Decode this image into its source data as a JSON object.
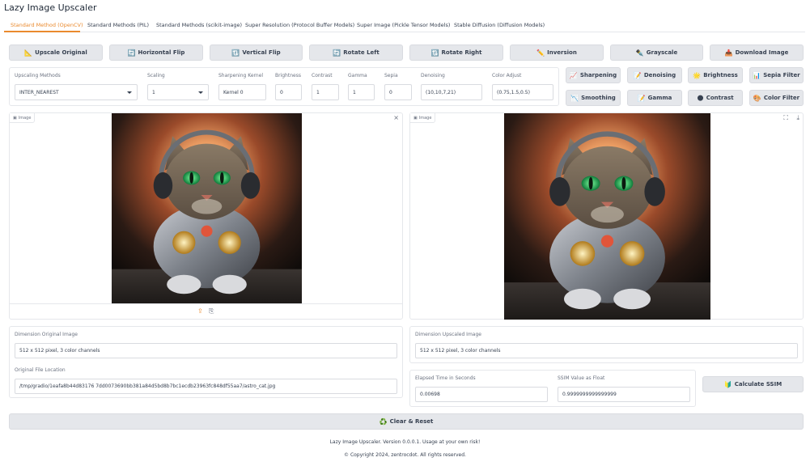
{
  "app": {
    "title": "Lazy Image Upscaler"
  },
  "tabs": [
    {
      "label": "Standard Method (OpenCV)"
    },
    {
      "label": "Standard Methods (PIL)"
    },
    {
      "label": "Standard Methods (scikit-image)"
    },
    {
      "label": "Super Resolution (Protocol Buffer Models)"
    },
    {
      "label": "Super Image (Pickle Tensor Models)"
    },
    {
      "label": "Stable Diffusion (Diffusion Models)"
    }
  ],
  "toolbar": [
    {
      "label": "Upscale Original",
      "icon": "📐"
    },
    {
      "label": "Horizontal Flip",
      "icon": "🔄"
    },
    {
      "label": "Vertical Flip",
      "icon": "🔃"
    },
    {
      "label": "Rotate Left",
      "icon": "🔄"
    },
    {
      "label": "Rotate Right",
      "icon": "🔃"
    },
    {
      "label": "Inversion",
      "icon": "✏️"
    },
    {
      "label": "Grayscale",
      "icon": "✒️"
    },
    {
      "label": "Download Image",
      "icon": "📥"
    }
  ],
  "settings": {
    "upscaling_methods": {
      "label": "Upscaling Methods",
      "value": "INTER_NEAREST"
    },
    "scaling": {
      "label": "Scaling",
      "value": "1"
    },
    "sharpening_kernel": {
      "label": "Sharpening Kernel",
      "value": "Kernel 0"
    },
    "brightness": {
      "label": "Brightness",
      "value": "0"
    },
    "contrast": {
      "label": "Contrast",
      "value": "1"
    },
    "gamma": {
      "label": "Gamma",
      "value": "1"
    },
    "sepia": {
      "label": "Sepia",
      "value": "0"
    },
    "denoising": {
      "label": "Denoising",
      "value": "(10,10,7,21)"
    },
    "color_adjust": {
      "label": "Color Adjust",
      "value": "(0.75,1.5,0.5)"
    }
  },
  "filters": [
    {
      "label": "Sharpening",
      "icon": "📈"
    },
    {
      "label": "Denoising",
      "icon": "📝"
    },
    {
      "label": "Brightness",
      "icon": "🌟"
    },
    {
      "label": "Sepia Filter",
      "icon": "📊"
    },
    {
      "label": "Smoothing",
      "icon": "📉"
    },
    {
      "label": "Gamma",
      "icon": "📝"
    },
    {
      "label": "Contrast",
      "icon": "🌑"
    },
    {
      "label": "Color Filter",
      "icon": "🎨"
    }
  ],
  "image_left": {
    "label": "Image",
    "close": "×",
    "upload": "⇪",
    "paste": "⎘"
  },
  "image_right": {
    "label": "Image",
    "fullscreen": "⛶",
    "download": "⤓"
  },
  "info": {
    "dim_original": {
      "label": "Dimension Original Image",
      "value": "512 x 512 pixel, 3 color channels"
    },
    "file_location": {
      "label": "Original File Location",
      "value": "/tmp/gradio/1eafa8b44d83176 7dd0073690bb381a84d5bd8b7bc1ecdb23963fc848df55aa7/astro_cat.jpg"
    },
    "dim_upscaled": {
      "label": "Dimension Upscaled Image",
      "value": "512 x 512 pixel, 3 color channels"
    },
    "elapsed": {
      "label": "Elapsed Time in Seconds",
      "value": "0.00698"
    },
    "ssim": {
      "label": "SSIM Value as Float",
      "value": "0.9999999999999999"
    }
  },
  "calc_ssim": {
    "label": "Calculate SSIM",
    "icon": "🔰"
  },
  "clear_reset": {
    "label": "Clear & Reset",
    "icon": "♻️"
  },
  "footer": {
    "line1": "Lazy Image Upscaler. Version 0.0.0.1. Usage at your own risk!",
    "line2": "© Copyright 2024, zentrocdot. All rights reserved."
  }
}
